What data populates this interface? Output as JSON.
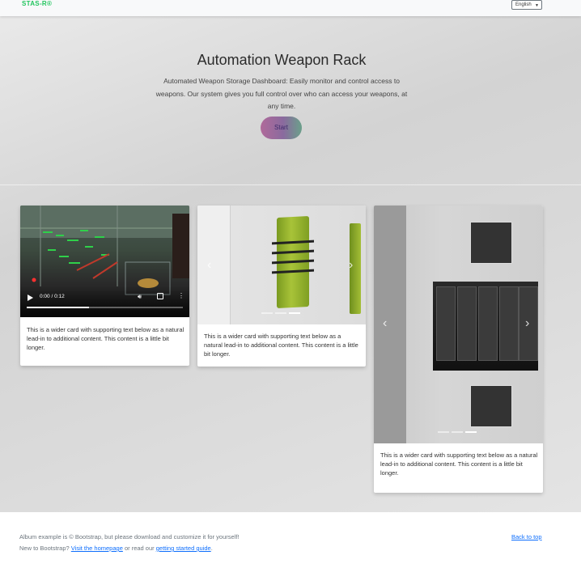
{
  "navbar": {
    "brand": "STAS-R®",
    "language": "English"
  },
  "hero": {
    "title": "Automation Weapon Rack",
    "description": "Automated Weapon Storage Dashboard: Easily monitor and control access to weapons. Our system gives you full control over who can access your weapons, at any time.",
    "start_label": "Start"
  },
  "cards": [
    {
      "text": "This is a wider card with supporting text below as a natural lead-in to additional content. This content is a little bit longer.",
      "video": {
        "time": "0:00 / 0:12",
        "progress": 0.4
      }
    },
    {
      "text": "This is a wider card with supporting text below as a natural lead-in to additional content. This content is a little bit longer.",
      "carousel": {
        "slides": 3,
        "active": 2
      }
    },
    {
      "text": "This is a wider card with supporting text below as a natural lead-in to additional content. This content is a little bit longer.",
      "carousel": {
        "slides": 3,
        "active": 2
      }
    }
  ],
  "footer": {
    "line1": "Album example is © Bootstrap, but please download and customize it for yourself!",
    "line2_prefix": "New to Bootstrap? ",
    "homepage_link": "Visit the homepage",
    "line2_middle": " or read our ",
    "guide_link": "getting started guide",
    "line2_suffix": ".",
    "back_to_top": "Back to top"
  },
  "colors": {
    "brand": "#22c55e",
    "link": "#0d6efd",
    "start_button_gradient": [
      "#b06a9a",
      "#6aa08a"
    ]
  }
}
